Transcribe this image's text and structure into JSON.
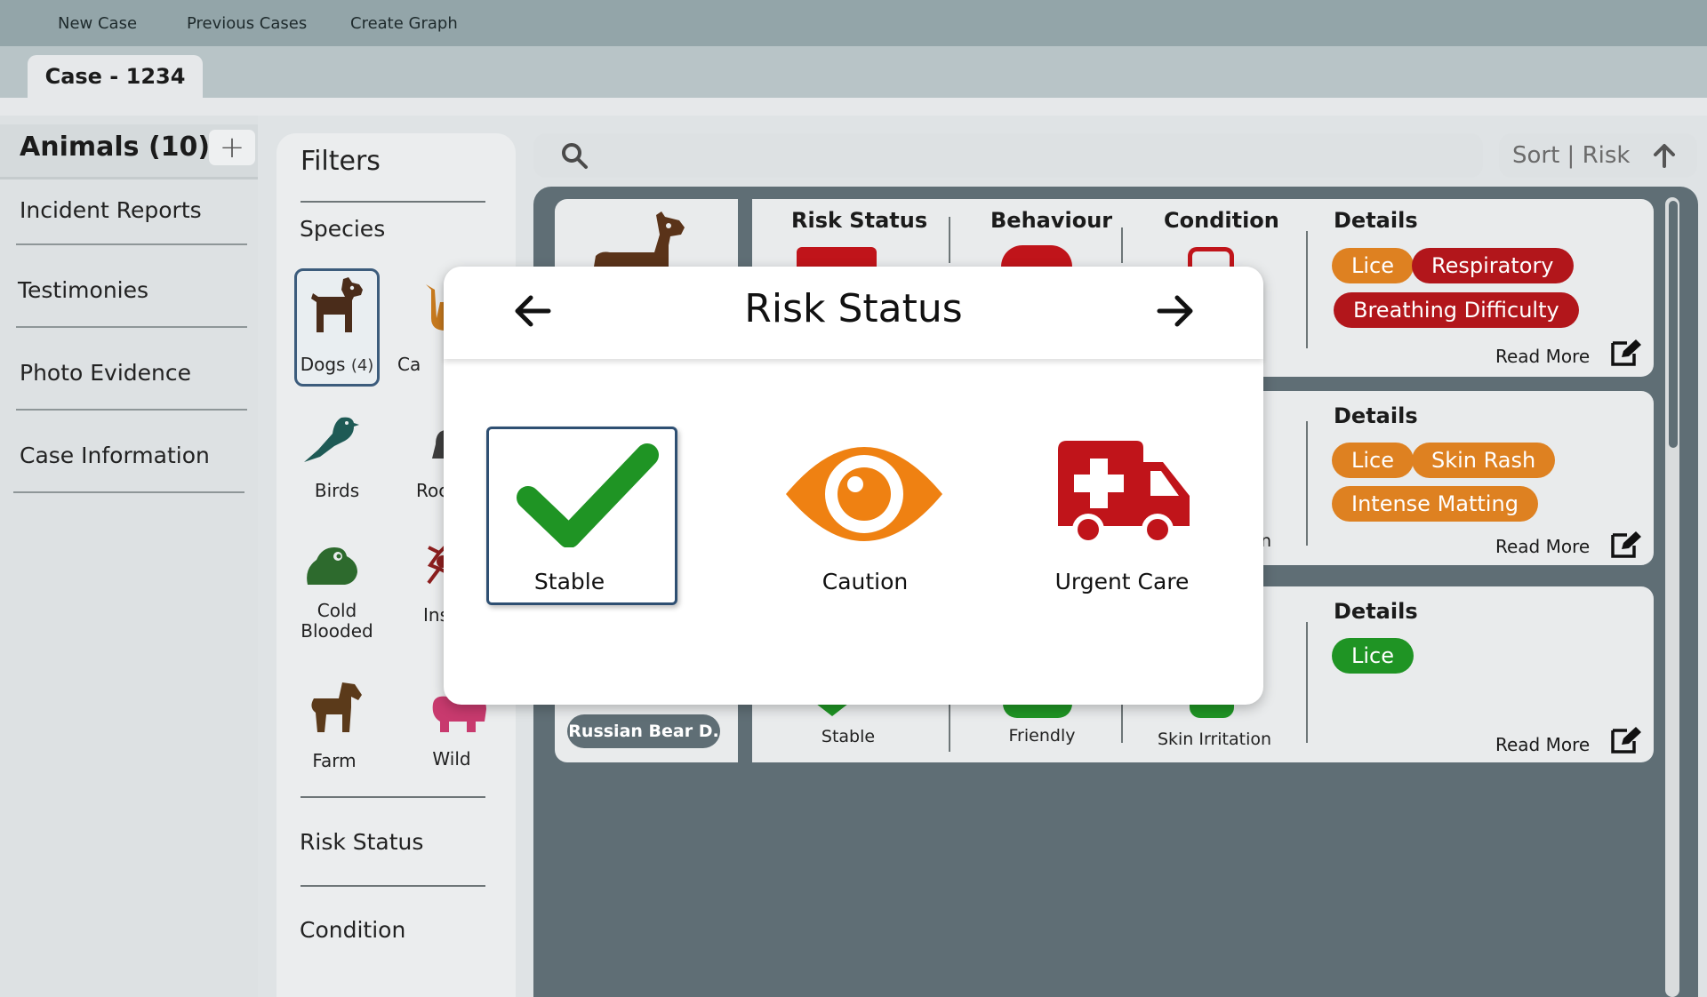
{
  "menu": {
    "items": [
      "New Case",
      "Previous Cases",
      "Create Graph"
    ]
  },
  "case_tab": {
    "label": "Case - 1234"
  },
  "sidebar": {
    "title": "Animals (10)",
    "add_label": "+",
    "items": [
      "Incident Reports",
      "Testimonies",
      "Photo Evidence",
      "Case Information"
    ]
  },
  "filters": {
    "title": "Filters",
    "species_heading": "Species",
    "species": [
      {
        "label": "Dogs",
        "count": "(4)"
      },
      {
        "label": "Ca"
      },
      {
        "label": "Birds"
      },
      {
        "label": "Roc"
      },
      {
        "label_line1": "Cold",
        "label_line2": "Blooded"
      },
      {
        "label": "Ins"
      },
      {
        "label": "Farm"
      },
      {
        "label": "Wild"
      }
    ],
    "risk_heading": "Risk  Status",
    "condition_heading": "Condition"
  },
  "search": {
    "placeholder": ""
  },
  "sort": {
    "label": "Sort | Risk"
  },
  "cards": [
    {
      "headers": {
        "risk": "Risk Status",
        "behaviour": "Behaviour",
        "condition": "Condition",
        "details": "Details"
      },
      "tags": [
        {
          "text": "Lice",
          "color": "orange"
        },
        {
          "text": "Respiratory",
          "color": "red"
        },
        {
          "text": "Breathing Difficulty",
          "color": "red"
        }
      ],
      "read_more": "Read More"
    },
    {
      "details": "Details",
      "condition_fragment": "n",
      "tags": [
        {
          "text": "Lice",
          "color": "orange"
        },
        {
          "text": "Skin Rash",
          "color": "orange"
        },
        {
          "text": "Intense Matting",
          "color": "orange"
        }
      ],
      "read_more": "Read More"
    },
    {
      "details": "Details",
      "name": "Russian Bear D.",
      "risk_value": "Stable",
      "behaviour_value": "Friendly",
      "condition_value": "Skin Irritation",
      "tags": [
        {
          "text": "Lice",
          "color": "green"
        }
      ],
      "read_more": "Read More"
    }
  ],
  "modal": {
    "title": "Risk Status",
    "options": [
      "Stable",
      "Caution",
      "Urgent Care"
    ],
    "selected": "Stable"
  },
  "colors": {
    "stable": "#1f9424",
    "caution": "#ef8112",
    "urgent": "#c0141a",
    "dog_brown": "#5a3319"
  }
}
